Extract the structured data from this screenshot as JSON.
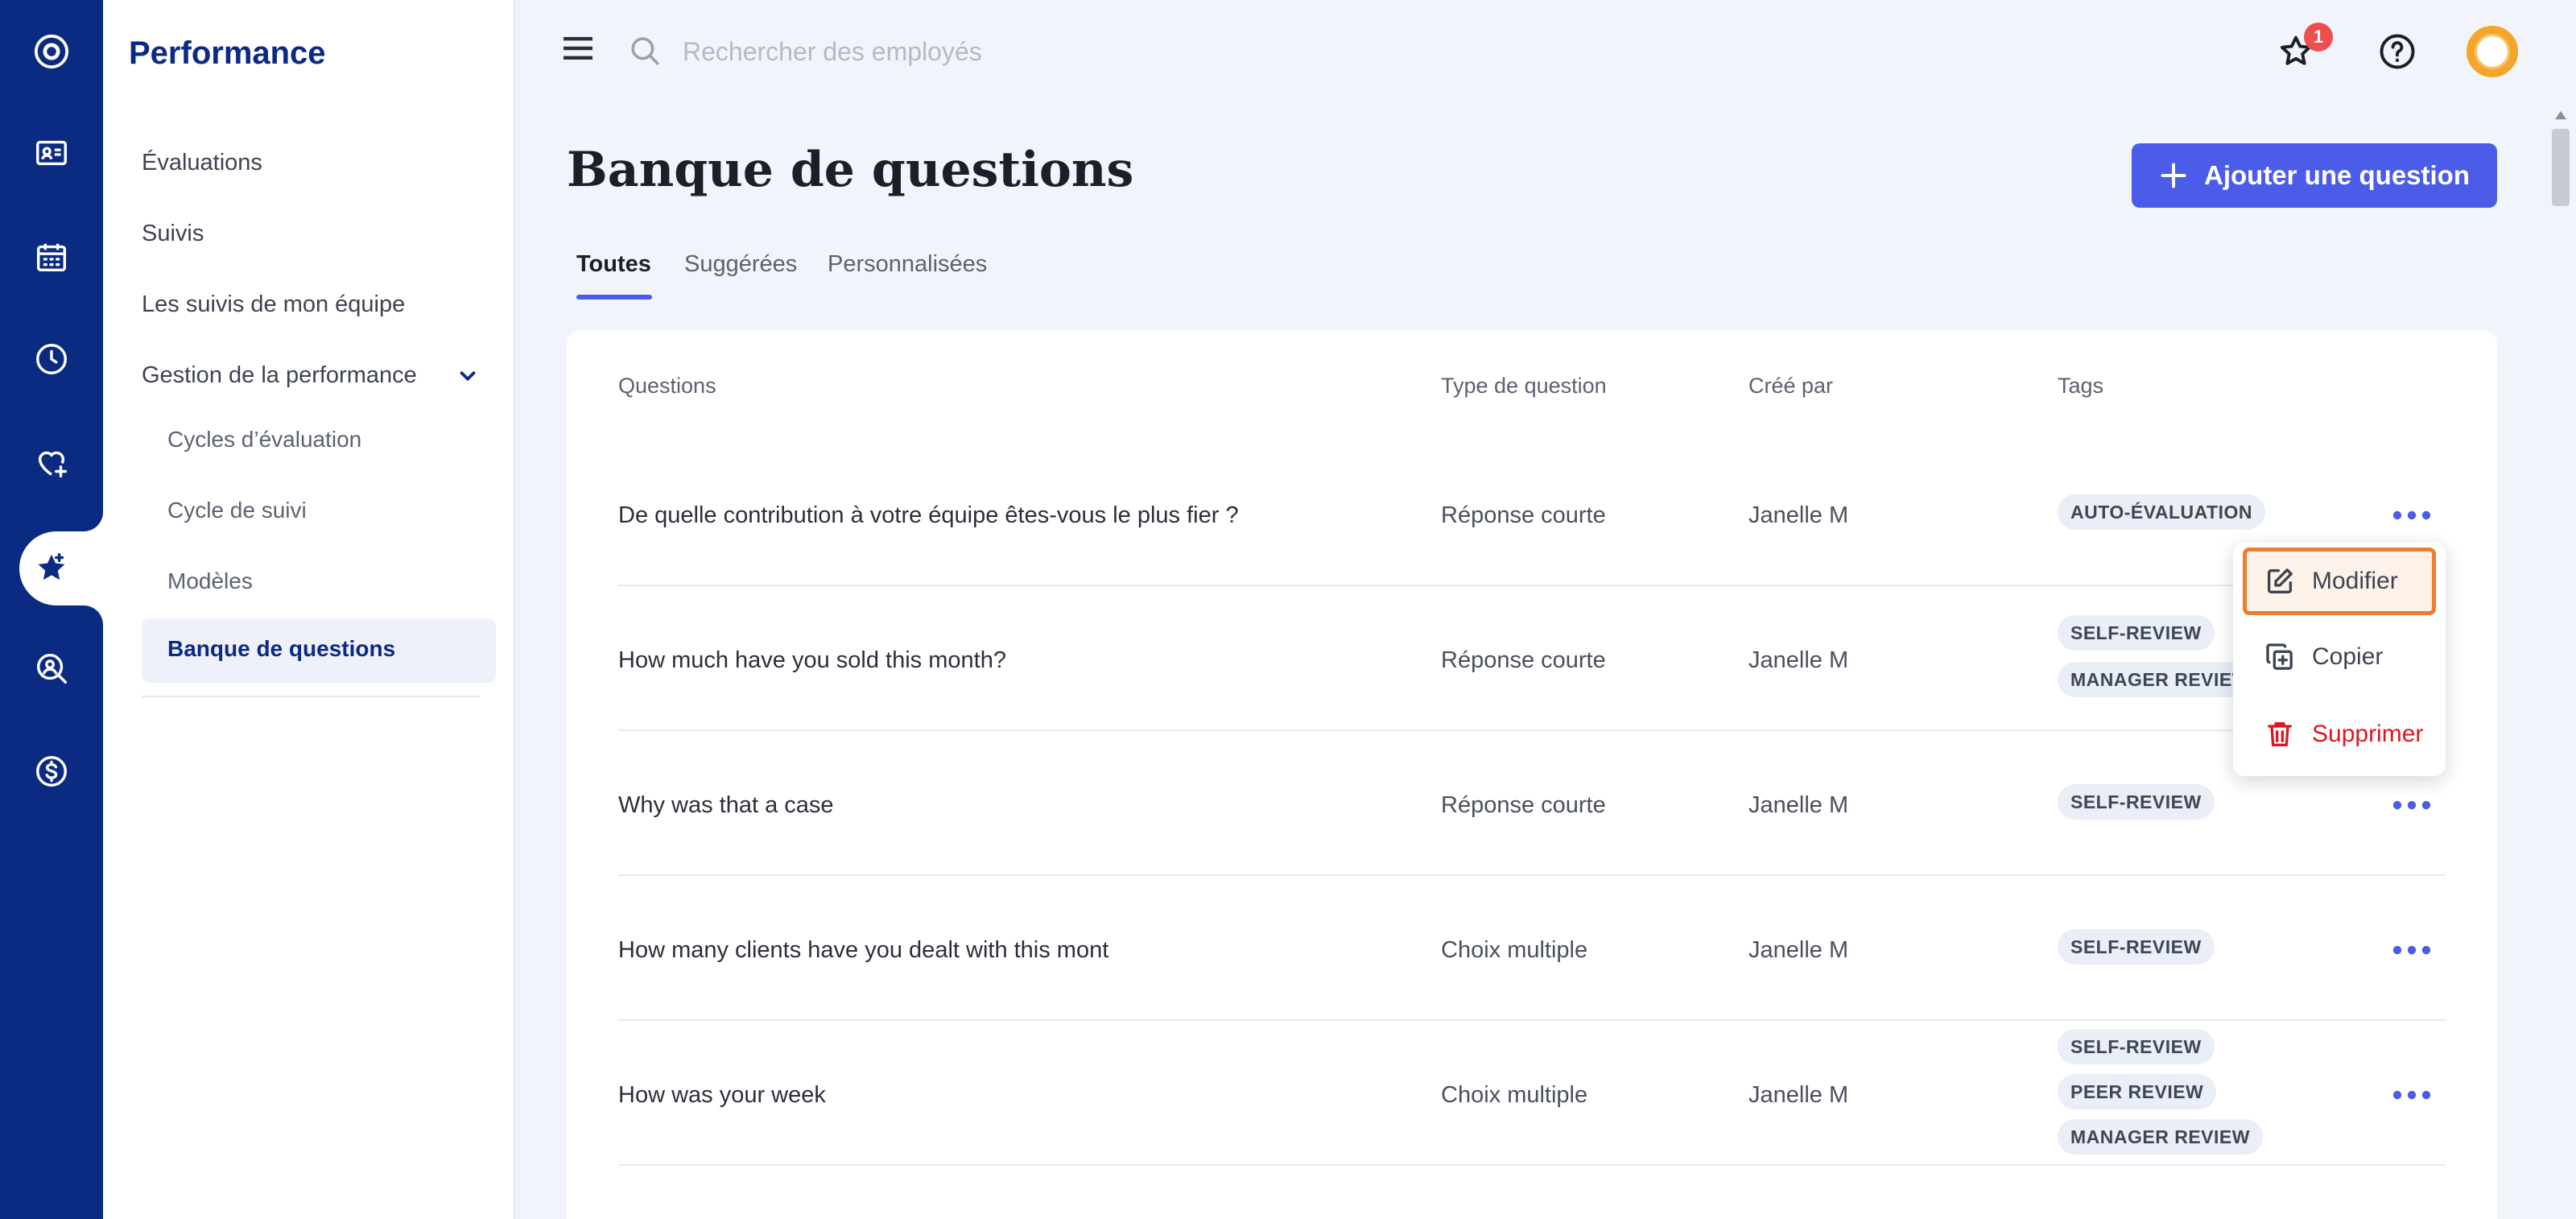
{
  "rail": {
    "icons": [
      "logo-icon",
      "id-card-icon",
      "calendar-icon",
      "clock-icon",
      "heart-plus-icon",
      "star-performance-icon",
      "search-person-icon",
      "dollar-icon"
    ]
  },
  "sidebar": {
    "title": "Performance",
    "items": [
      {
        "label": "Évaluations"
      },
      {
        "label": "Suivis"
      },
      {
        "label": "Les suivis de mon équipe"
      },
      {
        "label": "Gestion de la performance"
      }
    ],
    "sub_items": [
      {
        "label": "Cycles d’évaluation"
      },
      {
        "label": "Cycle de suivi"
      },
      {
        "label": "Modèles"
      },
      {
        "label": "Banque de questions"
      }
    ]
  },
  "topbar": {
    "search_placeholder": "Rechercher des employés",
    "notification_count": "1"
  },
  "page": {
    "title": "Banque de questions",
    "add_button": "Ajouter une question",
    "tabs": [
      "Toutes",
      "Suggérées",
      "Personnalisées"
    ]
  },
  "table": {
    "headers": [
      "Questions",
      "Type de question",
      "Créé par",
      "Tags"
    ],
    "rows": [
      {
        "question": "De quelle contribution à votre équipe êtes-vous le plus fier ?",
        "type": "Réponse courte",
        "by": "Janelle M",
        "tags": [
          "AUTO-ÉVALUATION"
        ]
      },
      {
        "question": "How much have you sold this month?",
        "type": "Réponse courte",
        "by": "Janelle M",
        "tags": [
          "SELF-REVIEW",
          "MANAGER REVIEW"
        ]
      },
      {
        "question": "Why was that a case",
        "type": "Réponse courte",
        "by": "Janelle M",
        "tags": [
          "SELF-REVIEW"
        ]
      },
      {
        "question": "How many clients have you dealt with this mont",
        "type": "Choix multiple",
        "by": "Janelle M",
        "tags": [
          "SELF-REVIEW"
        ]
      },
      {
        "question": "How was your week",
        "type": "Choix multiple",
        "by": "Janelle M",
        "tags": [
          "SELF-REVIEW",
          "PEER REVIEW",
          "MANAGER REVIEW"
        ]
      }
    ]
  },
  "menu": {
    "edit": "Modifier",
    "copy": "Copier",
    "delete": "Supprimer"
  },
  "colors": {
    "rail": "#0b2a82",
    "accent": "#4b5de8",
    "highlight": "#f07d2d",
    "danger": "#e0161f"
  }
}
